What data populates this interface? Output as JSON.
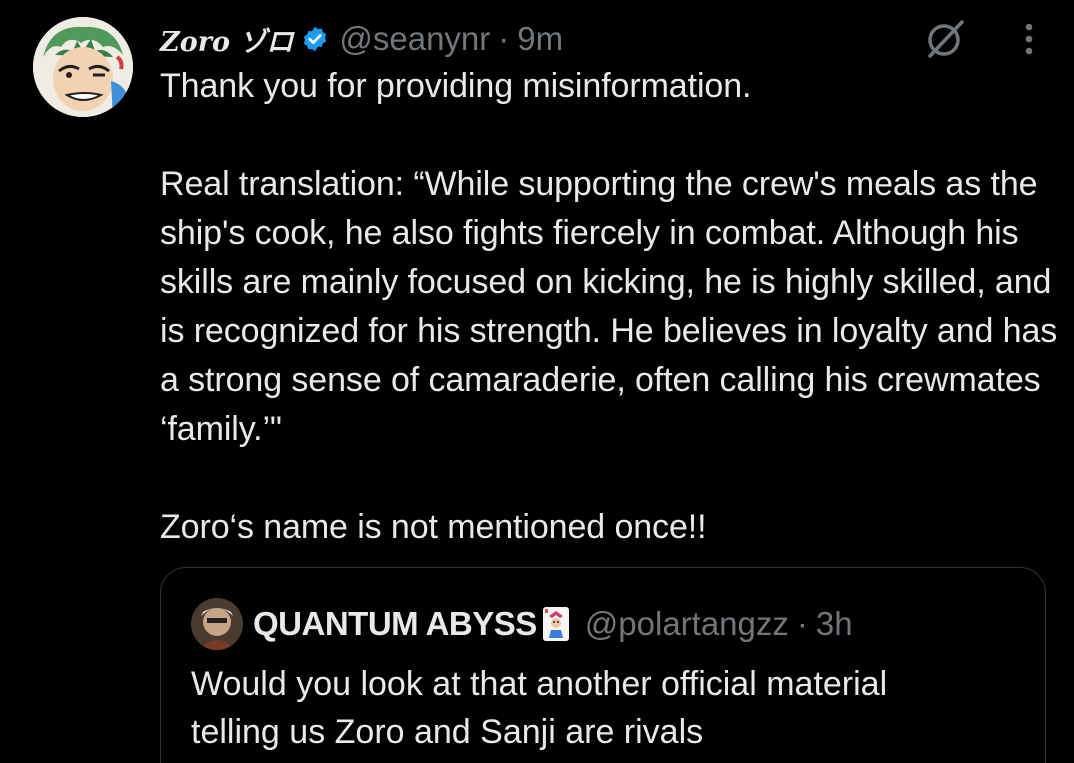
{
  "tweet": {
    "display_name": "Zoro ゾロ",
    "handle": "@seanynr",
    "separator": "·",
    "time": "9m",
    "verified": true,
    "avatar_icon": "zoro-avatar",
    "text": "Thank you for providing misinformation.\n\nReal translation: “While supporting the crew's meals as the ship's cook, he also fights fiercely in combat. Although his skills are mainly focused on kicking, he is highly skilled, and is recognized for his strength. He believes in loyalty and has a strong sense of camaraderie, often calling his crewmates ‘family.’\"\n\nZoro‘s name is not mentioned once!!"
  },
  "actions": {
    "grok_icon": "grok-icon",
    "more_icon": "more-vertical-icon"
  },
  "quoted": {
    "display_name": "QUANTUM ABYSS",
    "emoji_icon": "joker-card-icon",
    "handle": "@polartangzz",
    "separator": "·",
    "time": "3h",
    "text": "Would you look at that another official material\ntelling us Zoro and Sanji are rivals"
  },
  "colors": {
    "background": "#000000",
    "primary_text": "#e7e9ea",
    "secondary_text": "#71767b",
    "verified_blue": "#1d9bf0",
    "border": "#2f3336"
  }
}
